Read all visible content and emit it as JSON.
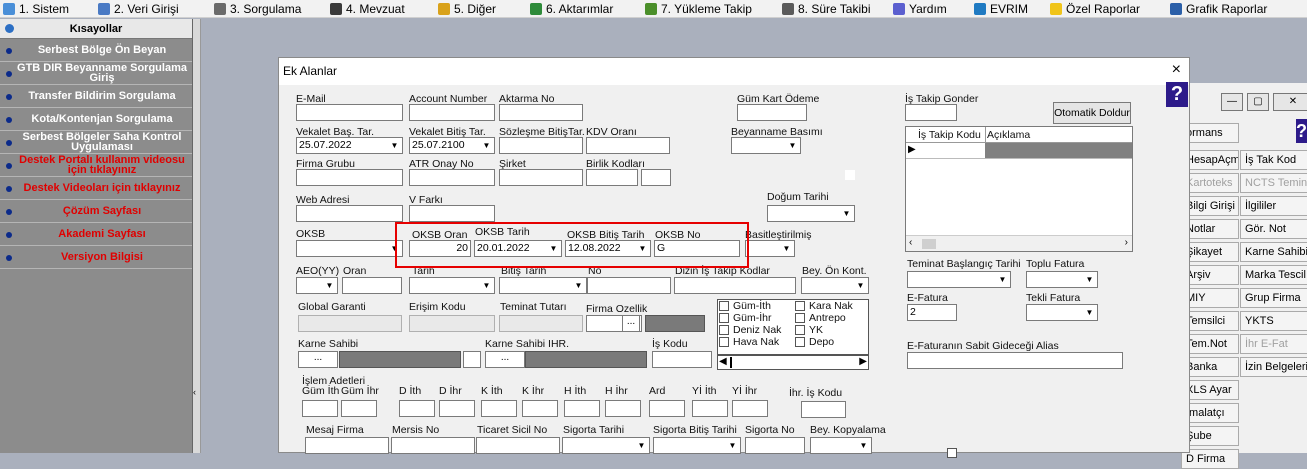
{
  "menu": [
    {
      "label": "1. Sistem",
      "icon": "system-icon",
      "color": "#4a8fd8"
    },
    {
      "label": "2. Veri Girişi",
      "icon": "data-entry-icon",
      "color": "#4a7ac4"
    },
    {
      "label": "3. Sorgulama",
      "icon": "query-icon",
      "color": "#6a6a6a"
    },
    {
      "label": "4. Mevzuat",
      "icon": "legislation-icon",
      "color": "#3a3a3a"
    },
    {
      "label": "5. Diğer",
      "icon": "other-icon",
      "color": "#d9a21b"
    },
    {
      "label": "6. Aktarımlar",
      "icon": "transfer-icon",
      "color": "#2e8b3a"
    },
    {
      "label": "7. Yükleme Takip",
      "icon": "upload-track-icon",
      "color": "#4b8f2a"
    },
    {
      "label": "8. Süre Takibi",
      "icon": "timer-icon",
      "color": "#5a5a5a"
    },
    {
      "label": "Yardım",
      "icon": "help-icon",
      "color": "#5b5fcf"
    },
    {
      "label": "EVRIM",
      "icon": "evrim-icon",
      "color": "#1f7ac2"
    },
    {
      "label": "Özel Raporlar",
      "icon": "star-icon",
      "color": "#f0c419"
    },
    {
      "label": "Grafik Raporlar",
      "icon": "chart-report-icon",
      "color": "#2b5fa8"
    }
  ],
  "sidebar": {
    "title": "Kısayollar",
    "items": [
      {
        "label": "Serbest Bölge Ön Beyan",
        "red": false
      },
      {
        "label": "GTB DIR Beyanname Sorgulama Giriş",
        "red": false
      },
      {
        "label": "Transfer Bildirim Sorgulama",
        "red": false
      },
      {
        "label": "Kota/Kontenjan Sorgulama",
        "red": false
      },
      {
        "label": "Serbest Bölgeler Saha Kontrol Uygulaması",
        "red": false
      },
      {
        "label": "Destek Portalı kullanım videosu için tıklayınız",
        "red": true
      },
      {
        "label": "Destek Videoları için tıklayınız",
        "red": true
      },
      {
        "label": "Çözüm Sayfası",
        "red": true
      },
      {
        "label": "Akademi Sayfası",
        "red": true
      },
      {
        "label": "Versiyon Bilgisi",
        "red": true
      }
    ]
  },
  "right_panel": {
    "buttons": [
      {
        "label": "ormans"
      },
      {
        "label": "HesapAçm"
      },
      {
        "label": "İş Tak Kod"
      },
      {
        "label": "Kartoteks"
      },
      {
        "label": "NCTS Teminat"
      },
      {
        "label": "Bilgi Girişi"
      },
      {
        "label": "İlgililer"
      },
      {
        "label": "Notlar"
      },
      {
        "label": "Gör. Not"
      },
      {
        "label": "Şikayet"
      },
      {
        "label": "Karne Sahibi"
      },
      {
        "label": "Arşiv"
      },
      {
        "label": "Marka Tescil"
      },
      {
        "label": "MIY"
      },
      {
        "label": "Grup Firma"
      },
      {
        "label": "Temsilci"
      },
      {
        "label": "YKTS"
      },
      {
        "label": "Tem.Not"
      },
      {
        "label": "İhr E-Fat"
      },
      {
        "label": "Banka"
      },
      {
        "label": "İzin Belgeleri"
      },
      {
        "label": "XLS Ayar"
      },
      {
        "label": "İmalatçı"
      },
      {
        "label": "Şube"
      },
      {
        "label": "D Firma"
      }
    ]
  },
  "dialog": {
    "title": "Ek Alanlar",
    "close": "×",
    "help": "?",
    "labels": {
      "email": "E-Mail",
      "account_number": "Account Number",
      "aktarma_no": "Aktarma No",
      "gum_kart_odeme": "Güm Kart Ödeme",
      "is_takip_gonder": "İş Takip Gonder",
      "vekalet_bas": "Vekalet Baş. Tar.",
      "vekalet_bitis": "Vekalet Bitiş Tar.",
      "sozlesme_bitis": "Sözleşme BitişTar.",
      "kdv_orani": "KDV Oranı",
      "beyanname_basimi": "Beyanname Basımı",
      "firma_grubu": "Firma Grubu",
      "atr_onay": "ATR Onay No",
      "sirket": "Şirket",
      "birlik_kodlari": "Birlik Kodları",
      "web_adresi": "Web Adresi",
      "v_farki": "V Farkı",
      "dogum_tarihi": "Doğum Tarihi",
      "oksb": "OKSB",
      "oksb_oran": "OKSB Oran",
      "oksb_tarih": "OKSB Tarih",
      "oksb_bitis": "OKSB Bitiş Tarih",
      "oksb_no": "OKSB No",
      "basitestirilmis": "Basitleştirilmiş",
      "aeo": "AEO(YY)",
      "oran": "Oran",
      "tarih": "Tarih",
      "bitis_tarih": "Bitiş Tarih",
      "no": "No",
      "dizin_is_takip": "Dizin İş Takip Kodlar",
      "bey_on_kont": "Bey. Ön Kont.",
      "global_garanti": "Global Garanti",
      "erisim_kodu": "Erişim Kodu",
      "teminat_tutari": "Teminat Tutarı",
      "firma_ozellik": "Firma Ozellik",
      "karne_sahibi": "Karne Sahibi",
      "karne_sahibi_ihr": "Karne Sahibi IHR.",
      "is_kodu": "İş Kodu",
      "islem_adetleri": "İşlem Adetleri",
      "ihr_is_kodu": "İhr. İş Kodu",
      "mesaj_firma": "Mesaj Firma",
      "mersis_no": "Mersis No",
      "ticaret_sicil": "Ticaret Sicil No",
      "sigorta_tarihi": "Sigorta Tarihi",
      "sigorta_bitis": "Sigorta Bitiş Tarihi",
      "sigorta_no": "Sigorta No",
      "bey_kopyalama": "Bey. Kopyalama",
      "teminat_bas": "Teminat Başlangıç Tarihi",
      "toplu_fatura": "Toplu Fatura",
      "e_fatura": "E-Fatura",
      "tekli_fatura": "Tekli Fatura",
      "e_fatura_alias": "E-Faturanın Sabit Gideceği Alias"
    },
    "values": {
      "vekalet_bas": "25.07.2022",
      "vekalet_bitis": "25.07.2100",
      "oksb_oran": "20",
      "oksb_tarih": "20.01.2022",
      "oksb_bitis": "12.08.2022",
      "oksb_no": "G",
      "e_fatura": "2"
    },
    "ellipsis": "...",
    "otomatik_doldur": "Otomatik Doldur",
    "grid_headers": [
      "İş Takip Kodu",
      "Açıklama"
    ],
    "checkboxes": [
      {
        "label": "Güm-İth"
      },
      {
        "label": "Kara Nak"
      },
      {
        "label": "Güm-İhr"
      },
      {
        "label": "Antrepo"
      },
      {
        "label": "Deniz Nak"
      },
      {
        "label": "YK"
      },
      {
        "label": "Hava Nak"
      },
      {
        "label": "Depo"
      }
    ],
    "islem_cols": [
      "Güm İth",
      "Güm İhr",
      "D İth",
      "D İhr",
      "K İth",
      "K İhr",
      "H İth",
      "H İhr",
      "Ard",
      "Yİ İth",
      "Yİ İhr"
    ]
  }
}
